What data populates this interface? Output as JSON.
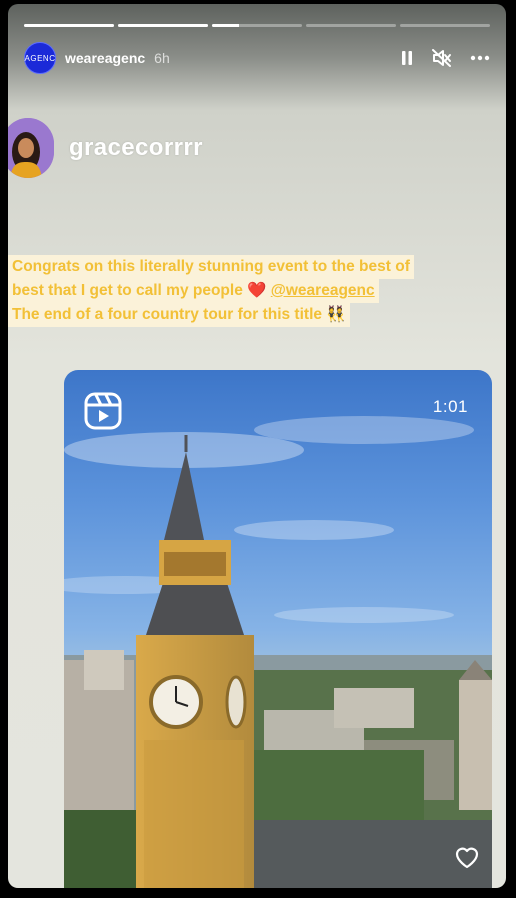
{
  "story": {
    "account": "weareagenc",
    "avatar_text": "AGENC",
    "time": "6h",
    "progress": [
      1,
      1,
      0.3,
      0,
      0
    ]
  },
  "post": {
    "username": "gracecorrrr",
    "caption": {
      "line1": "Congrats on this literally stunning event to the best of",
      "line2_pre": "best that I get to call my people",
      "line2_heart": "❤️",
      "line2_mention": "@weareagenc",
      "line3": "The end of a four country tour for this title",
      "line3_emoji": "👯"
    }
  },
  "reel": {
    "duration": "1:01"
  },
  "icons": [
    "pause-icon",
    "mute-icon",
    "more-icon",
    "reels-icon",
    "heart-icon"
  ],
  "colors": {
    "caption_text": "#f2c037",
    "caption_bg": "#fbf2d9",
    "avatar_bg": "#1b2ad8"
  }
}
